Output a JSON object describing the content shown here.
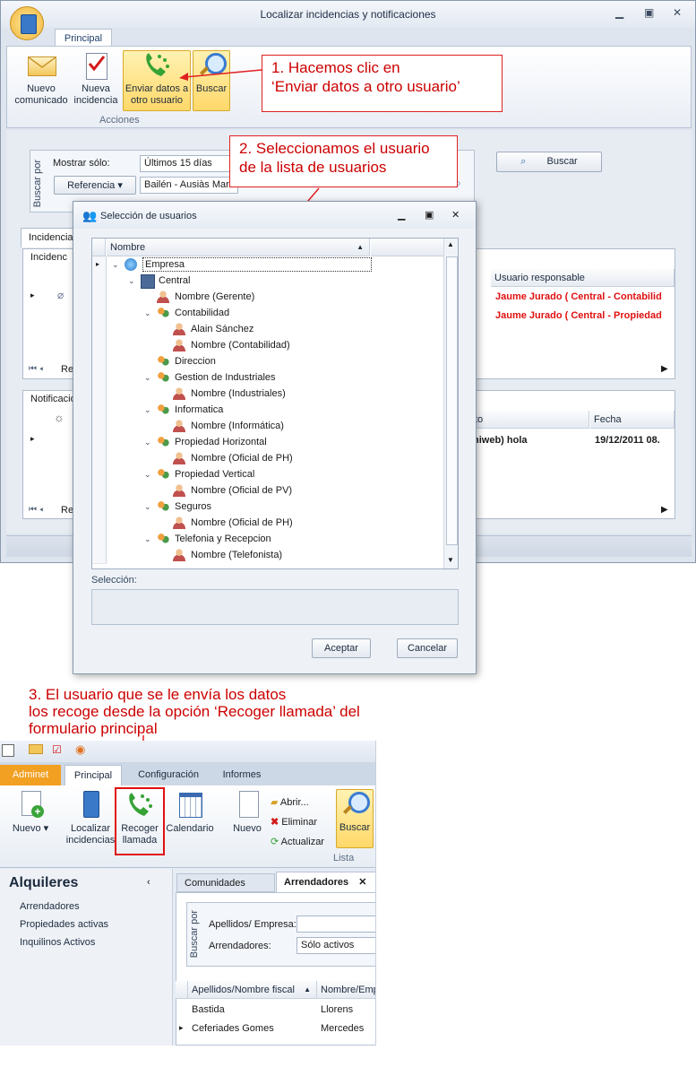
{
  "window": {
    "title": "Localizar incidencias y notificaciones",
    "tab_principal": "Principal",
    "ribbon_buttons": [
      "Nuevo comunicado",
      "Nueva incidencia",
      "Enviar datos a otro usuario",
      "Buscar"
    ],
    "group_label": "Acciones"
  },
  "search": {
    "mostrar_label": "Mostrar sólo:",
    "mostrar_value": "Últimos 15 días",
    "referencia": "Referencia",
    "usuario_value": "Bailén - Ausiàs March",
    "buscar_por": "Buscar por",
    "buscar_button": "Buscar"
  },
  "incidencias": {
    "tab": "Incidencias",
    "group": "Incidenc",
    "col_responsable": "Usuario responsable",
    "rows": [
      "Jaume Jurado ( Central - Contabilid",
      "Jaume Jurado ( Central - Propiedad"
    ],
    "nav_text": "Reg"
  },
  "notificaciones": {
    "group": "Notificacio",
    "col_asunto": "to",
    "col_fecha": "Fecha",
    "row_asunto": "niweb) hola",
    "row_fecha": "19/12/2011 08.",
    "nav_text": "Reg"
  },
  "callouts": {
    "c1": [
      "1. Hacemos clic en",
      "‘Enviar datos a otro usuario’"
    ],
    "c2": [
      "2. Seleccionamos el usuario",
      "de la lista de usuarios"
    ],
    "c3": [
      "3. El usuario que se le envía los datos",
      "los recoge desde la opción ‘Recoger llamada’ del",
      "formulario principal"
    ]
  },
  "dialog": {
    "title": "Selección de usuarios",
    "column": "Nombre",
    "tree": [
      {
        "label": "Empresa",
        "level": 0,
        "icon": "globe-icon",
        "exp": "v"
      },
      {
        "label": "Central",
        "level": 1,
        "icon": "building-icon",
        "exp": "v"
      },
      {
        "label": "Nombre (Gerente)",
        "level": 2,
        "icon": "user-icon",
        "exp": ""
      },
      {
        "label": "Contabilidad",
        "level": 2,
        "icon": "group-icon",
        "exp": "v"
      },
      {
        "label": "Alain Sánchez",
        "level": 3,
        "icon": "user-icon",
        "exp": ""
      },
      {
        "label": "Nombre (Contabilidad)",
        "level": 3,
        "icon": "user-icon",
        "exp": ""
      },
      {
        "label": "Direccion",
        "level": 2,
        "icon": "group-icon",
        "exp": ""
      },
      {
        "label": "Gestion de Industriales",
        "level": 2,
        "icon": "group-icon",
        "exp": "v"
      },
      {
        "label": "Nombre (Industriales)",
        "level": 3,
        "icon": "user-icon",
        "exp": ""
      },
      {
        "label": "Informatica",
        "level": 2,
        "icon": "group-icon",
        "exp": "v"
      },
      {
        "label": "Nombre (Informática)",
        "level": 3,
        "icon": "user-icon",
        "exp": ""
      },
      {
        "label": "Propiedad Horizontal",
        "level": 2,
        "icon": "group-icon",
        "exp": "v"
      },
      {
        "label": "Nombre (Oficial de PH)",
        "level": 3,
        "icon": "user-icon",
        "exp": ""
      },
      {
        "label": "Propiedad Vertical",
        "level": 2,
        "icon": "group-icon",
        "exp": "v"
      },
      {
        "label": "Nombre (Oficial de PV)",
        "level": 3,
        "icon": "user-icon",
        "exp": ""
      },
      {
        "label": "Seguros",
        "level": 2,
        "icon": "group-icon",
        "exp": "v"
      },
      {
        "label": "Nombre (Oficial de PH)",
        "level": 3,
        "icon": "user-icon",
        "exp": ""
      },
      {
        "label": "Telefonia y Recepcion",
        "level": 2,
        "icon": "group-icon",
        "exp": "v"
      },
      {
        "label": "Nombre (Telefonista)",
        "level": 3,
        "icon": "user-icon",
        "exp": ""
      }
    ],
    "seleccion_label": "Selección:",
    "accept": "Aceptar",
    "cancel": "Cancelar"
  },
  "app2": {
    "tabs": [
      "Adminet",
      "Principal",
      "Configuración",
      "Informes"
    ],
    "buttons": [
      "Nuevo",
      "Localizar incidencias",
      "Recoger llamada",
      "Calendario",
      "Nuevo"
    ],
    "small_buttons": [
      "Abrir...",
      "Eliminar",
      "Actualizar"
    ],
    "buscar": "Buscar",
    "lista_label": "Lista",
    "nav_title": "Alquileres",
    "nav_items": [
      "Arrendadores",
      "Propiedades activas",
      "Inquilinos Activos"
    ],
    "doc_tabs": [
      "Comunidades",
      "Arrendadores"
    ],
    "buscar_por": "Buscar por",
    "apellidos_label": "Apellidos/ Empresa:",
    "arrendadores_label": "Arrendadores:",
    "arrendadores_value": "Sólo activos",
    "columns": [
      "Apellidos/Nombre fiscal",
      "Nombre/Empr"
    ],
    "rows": [
      [
        "Bastida",
        "Llorens"
      ],
      [
        "Ceferiades Gomes",
        "Mercedes"
      ]
    ]
  },
  "colors": {
    "accent_red": "#e01010",
    "ribbon_highlight": "#ffd869",
    "window_border": "#8a98ab"
  }
}
